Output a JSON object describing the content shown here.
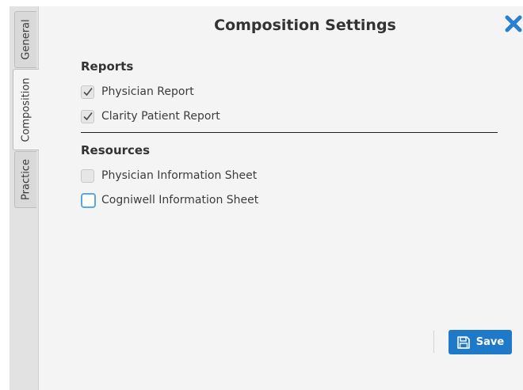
{
  "dialog": {
    "title": "Composition Settings"
  },
  "tabs": [
    {
      "label": "General",
      "active": false
    },
    {
      "label": "Composition",
      "active": true
    },
    {
      "label": "Practice",
      "active": false
    }
  ],
  "reports": {
    "heading": "Reports",
    "items": [
      {
        "label": "Physician Report",
        "checked": true
      },
      {
        "label": "Clarity Patient Report",
        "checked": true
      }
    ]
  },
  "resources": {
    "heading": "Resources",
    "items": [
      {
        "label": "Physician Information Sheet",
        "checked": false
      },
      {
        "label": "Cogniwell Information Sheet",
        "checked": false,
        "focused": true
      }
    ]
  },
  "actions": {
    "save_label": "Save"
  },
  "icons": {
    "close": "close-icon",
    "save": "floppy-disk-icon",
    "check": "checkmark-icon"
  },
  "colors": {
    "accent": "#1f79c9",
    "close": "#2b7fd0",
    "focus_ring": "#5aa7dc"
  }
}
